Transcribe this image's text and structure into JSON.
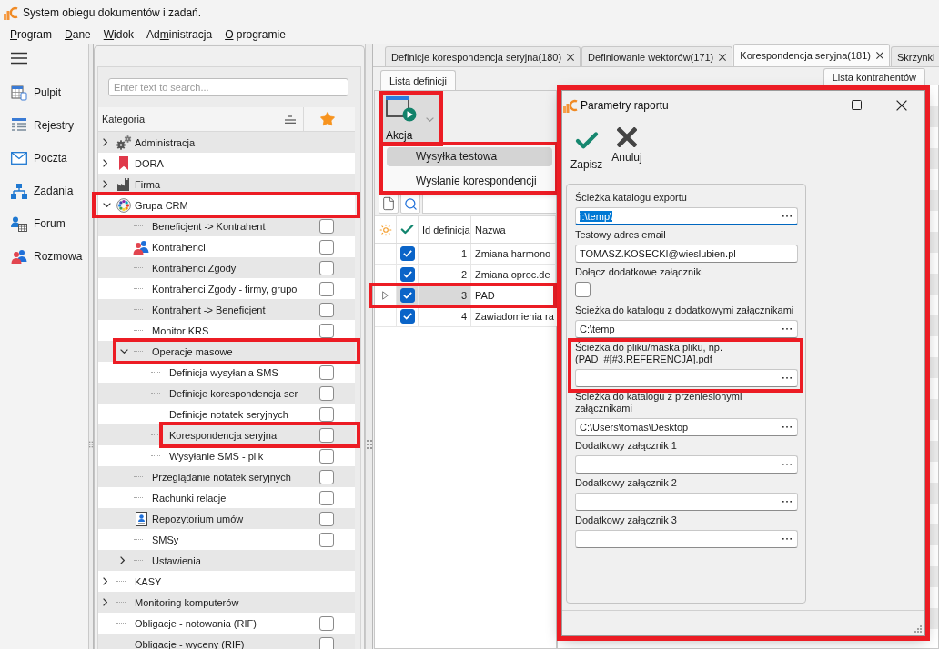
{
  "window": {
    "title": "System obiegu dokumentów i zadań."
  },
  "menu": [
    {
      "key": "P",
      "after": "rogram"
    },
    {
      "key": "D",
      "after": "ane"
    },
    {
      "key": "W",
      "after": "idok"
    },
    {
      "before": "Ad",
      "key": "m",
      "after": "inistracja"
    },
    {
      "key": "O",
      "after": " programie"
    }
  ],
  "nav": [
    {
      "label": "Pulpit"
    },
    {
      "label": "Rejestry"
    },
    {
      "label": "Poczta"
    },
    {
      "label": "Zadania"
    },
    {
      "label": "Forum"
    },
    {
      "label": "Rozmowa"
    }
  ],
  "tree": {
    "search": {
      "placeholder": "Enter text to search..."
    },
    "column": "Kategoria",
    "items": [
      {
        "kind": "folder",
        "label": "Administracja",
        "expanded": false,
        "highlighted": false
      },
      {
        "kind": "folder",
        "label": "DORA",
        "expanded": false,
        "highlighted": false
      },
      {
        "kind": "folder",
        "label": "Firma",
        "expanded": false,
        "highlighted": false
      },
      {
        "kind": "folder",
        "label": "Grupa CRM",
        "expanded": true,
        "highlighted": true,
        "children": [
          {
            "kind": "leaf",
            "label": "Beneficjent -> Kontrahent",
            "checked": false,
            "highlighted": false
          },
          {
            "kind": "leaf",
            "label": "Kontrahenci",
            "checked": false,
            "highlighted": false
          },
          {
            "kind": "leaf",
            "label": "Kontrahenci Zgody",
            "checked": false,
            "highlighted": false
          },
          {
            "kind": "leaf",
            "label": "Kontrahenci Zgody - firmy, grupo",
            "checked": false,
            "highlighted": false
          },
          {
            "kind": "leaf",
            "label": "Kontrahent -> Beneficjent",
            "checked": false,
            "highlighted": false
          },
          {
            "kind": "leaf",
            "label": "Monitor KRS",
            "checked": false,
            "highlighted": false
          },
          {
            "kind": "folder",
            "label": "Operacje masowe",
            "expanded": true,
            "highlighted": true,
            "children": [
              {
                "kind": "leaf",
                "label": "Definicja wysyłania SMS",
                "checked": false,
                "highlighted": false
              },
              {
                "kind": "leaf",
                "label": "Definicje korespondencja ser",
                "checked": false,
                "highlighted": false
              },
              {
                "kind": "leaf",
                "label": "Definicje notatek seryjnych",
                "checked": false,
                "highlighted": false
              },
              {
                "kind": "leaf",
                "label": "Korespondencja seryjna",
                "checked": false,
                "highlighted": true
              },
              {
                "kind": "leaf",
                "label": "Wysyłanie SMS - plik",
                "checked": false,
                "highlighted": false
              }
            ]
          },
          {
            "kind": "leaf",
            "label": "Przeglądanie notatek seryjnych",
            "checked": false,
            "highlighted": false
          },
          {
            "kind": "leaf",
            "label": "Rachunki relacje",
            "checked": false,
            "highlighted": false
          },
          {
            "kind": "leaf",
            "label": "Repozytorium umów",
            "checked": false,
            "highlighted": false
          },
          {
            "kind": "leaf",
            "label": "SMSy",
            "checked": false,
            "highlighted": false
          },
          {
            "kind": "folder",
            "label": "Ustawienia",
            "expanded": false,
            "highlighted": false
          }
        ]
      },
      {
        "kind": "folder",
        "label": "KASY",
        "expanded": false,
        "highlighted": false
      },
      {
        "kind": "folder",
        "label": "Monitoring komputerów",
        "expanded": false,
        "highlighted": false
      },
      {
        "kind": "leaf",
        "label": "Obligacje - notowania (RIF)",
        "checked": false,
        "highlighted": false
      },
      {
        "kind": "leaf",
        "label": "Obligacje - wyceny (RIF)",
        "checked": false,
        "highlighted": false
      }
    ]
  },
  "document_tabs": [
    {
      "label": "Definicje korespondencja seryjna(180)",
      "selected": false,
      "closable": true
    },
    {
      "label": "Definiowanie wektorów(171)",
      "selected": false,
      "closable": true
    },
    {
      "label": "Korespondencja seryjna(181)",
      "selected": true,
      "closable": true
    },
    {
      "label": "Skrzynki",
      "selected": false,
      "closable": false
    }
  ],
  "definitions_panel": {
    "tab": {
      "label": "Lista definicji"
    },
    "action_button": {
      "label": "Akcja",
      "highlighted": true
    },
    "action_menu": {
      "highlighted": true,
      "items": [
        {
          "label": "Wysyłka testowa",
          "selected": true
        },
        {
          "label": "Wysłanie korespondencji",
          "selected": false
        }
      ]
    },
    "grid": {
      "columns": [
        {
          "kind": "indicator"
        },
        {
          "kind": "checkbox"
        },
        {
          "kind": "text",
          "label": "Id definicja"
        },
        {
          "kind": "text",
          "label": "Nazwa"
        }
      ],
      "rows": [
        {
          "checked": true,
          "selected": false,
          "highlighted": false,
          "cells": [
            "1",
            "Zmiana harmono"
          ]
        },
        {
          "checked": true,
          "selected": false,
          "highlighted": false,
          "cells": [
            "2",
            "Zmiana oproc.de"
          ]
        },
        {
          "checked": true,
          "selected": true,
          "highlighted": true,
          "cells": [
            "3",
            "PAD"
          ]
        },
        {
          "checked": true,
          "selected": false,
          "highlighted": false,
          "cells": [
            "4",
            "Zawiadomienia ra"
          ]
        }
      ]
    }
  },
  "contractors_panel": {
    "tab": {
      "label": "Lista kontrahentów"
    }
  },
  "dialog": {
    "title": "Parametry raportu",
    "highlighted": true,
    "toolbar": [
      {
        "label": "Zapisz"
      },
      {
        "label": "Anuluj"
      }
    ],
    "fields": [
      {
        "kind": "path",
        "label_lines": [
          "Ścieżka katalogu exportu"
        ],
        "value": "i:\\temp\\",
        "focused": true,
        "highlighted": false
      },
      {
        "kind": "text",
        "label_lines": [
          "Testowy adres email"
        ],
        "value": "TOMASZ.KOSECKI@wieslubien.pl",
        "focused": false,
        "highlighted": false
      },
      {
        "kind": "checkbox",
        "label_lines": [
          "Dołącz dodatkowe załączniki"
        ],
        "checked": false,
        "highlighted": false
      },
      {
        "kind": "path",
        "label_lines": [
          "Ścieżka do katalogu z dodatkowymi załącznikami"
        ],
        "value": "C:\\temp",
        "focused": false,
        "highlighted": false
      },
      {
        "kind": "path",
        "label_lines": [
          "Ścieżka do pliku/maska pliku, np.",
          "(PAD_#[#3.REFERENCJA].pdf"
        ],
        "focused": false,
        "highlighted": true
      },
      {
        "kind": "path",
        "label_lines": [
          "Ścieżka do katalogu z przeniesionymi",
          "załącznikami"
        ],
        "value": "C:\\Users\\tomas\\Desktop",
        "focused": false,
        "highlighted": false
      },
      {
        "kind": "path",
        "label_lines": [
          "Dodatkowy załącznik 1"
        ],
        "focused": false,
        "highlighted": false
      },
      {
        "kind": "path",
        "label_lines": [
          "Dodatkowy załącznik 2"
        ],
        "focused": false,
        "highlighted": false
      },
      {
        "kind": "path",
        "label_lines": [
          "Dodatkowy załącznik 3"
        ],
        "focused": false,
        "highlighted": false
      }
    ]
  }
}
